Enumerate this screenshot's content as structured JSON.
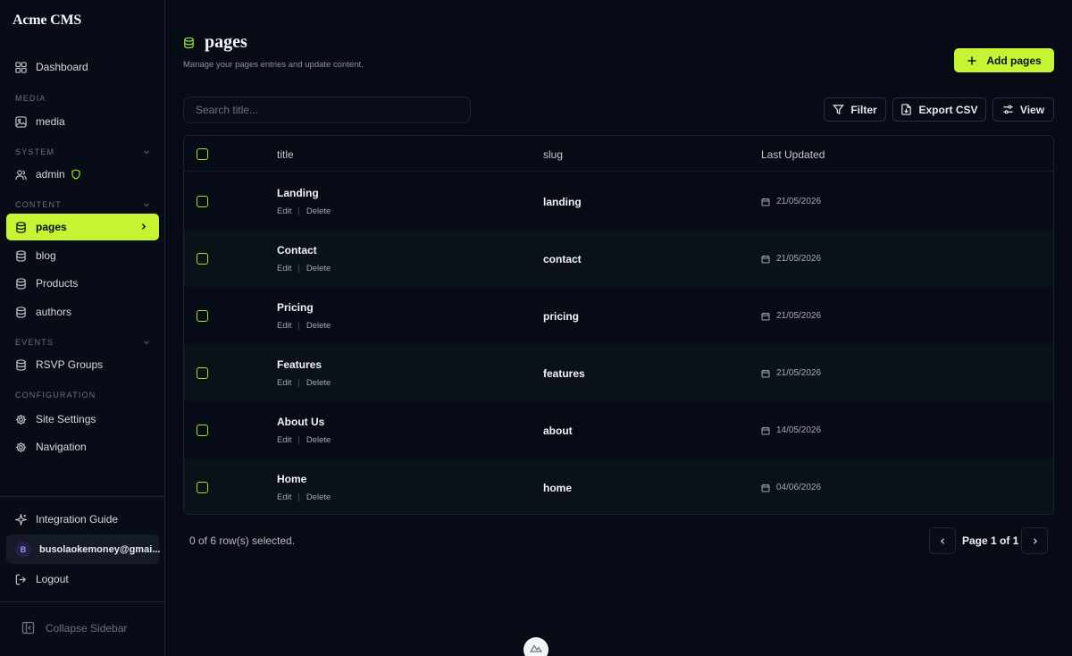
{
  "app": {
    "brand": "Acme CMS"
  },
  "sidebar": {
    "dashboard": "Dashboard",
    "sections": {
      "media": "MEDIA",
      "system": "SYSTEM",
      "content": "CONTENT",
      "events": "EVENTS",
      "configuration": "CONFIGURATION"
    },
    "items": {
      "media": "media",
      "admin": "admin",
      "pages": "pages",
      "blog": "blog",
      "products": "Products",
      "authors": "authors",
      "rsvp_groups": "RSVP Groups",
      "site_settings": "Site Settings",
      "navigation": "Navigation"
    },
    "integration_guide": "Integration Guide",
    "user": {
      "initial": "B",
      "email": "busolaokemoney@gmai..."
    },
    "logout": "Logout",
    "collapse": "Collapse Sidebar"
  },
  "header": {
    "title": "pages",
    "subtitle": "Manage your pages entries and update content.",
    "add_button": "Add pages"
  },
  "toolbar": {
    "search_placeholder": "Search title...",
    "filter": "Filter",
    "export": "Export CSV",
    "view": "View"
  },
  "table": {
    "columns": {
      "title": "title",
      "slug": "slug",
      "updated": "Last Updated"
    },
    "edit_label": "Edit",
    "delete_label": "Delete",
    "rows": [
      {
        "title": "Landing",
        "slug": "landing",
        "updated": "21/05/2026"
      },
      {
        "title": "Contact",
        "slug": "contact",
        "updated": "21/05/2026"
      },
      {
        "title": "Pricing",
        "slug": "pricing",
        "updated": "21/05/2026"
      },
      {
        "title": "Features",
        "slug": "features",
        "updated": "21/05/2026"
      },
      {
        "title": "About Us",
        "slug": "about",
        "updated": "14/05/2026"
      },
      {
        "title": "Home",
        "slug": "home",
        "updated": "04/06/2026"
      }
    ]
  },
  "footer": {
    "selected": "0 of 6 row(s) selected.",
    "page_label": "Page 1 of 1"
  },
  "colors": {
    "accent": "#c6f432",
    "background": "#060b15"
  },
  "icons": {
    "dashboard": "grid-icon",
    "media": "image-icon",
    "admin": "users-icon",
    "collections": "database-icon",
    "settings": "gear-icon",
    "integration": "sparkle-icon",
    "logout": "logout-icon"
  }
}
